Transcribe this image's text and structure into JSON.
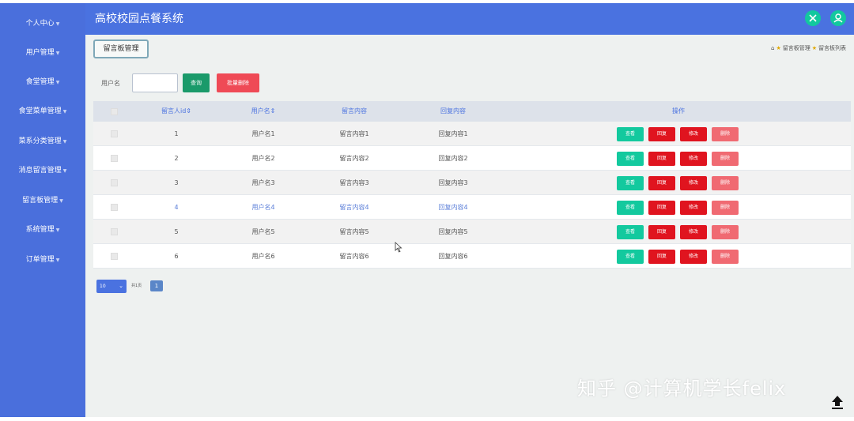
{
  "app": {
    "title": "高校校园点餐系统"
  },
  "sidebar": {
    "items": [
      {
        "label": "个人中心"
      },
      {
        "label": "用户管理"
      },
      {
        "label": "食堂管理"
      },
      {
        "label": "食堂菜单管理"
      },
      {
        "label": "菜系分类管理"
      },
      {
        "label": "消息留言管理"
      },
      {
        "label": "留言板管理"
      },
      {
        "label": "系统管理"
      },
      {
        "label": "订单管理"
      }
    ]
  },
  "header": {
    "icons": [
      "expand-icon",
      "user-icon"
    ]
  },
  "page": {
    "tab_label": "留言板管理",
    "breadcrumb": {
      "level1": "留言板管理",
      "level2": "留言板列表"
    }
  },
  "search": {
    "label": "用户名",
    "value": "",
    "query_button": "查询",
    "batch_delete_button": "批量删除"
  },
  "table": {
    "headers": [
      "留言人id⇕",
      "用户名⇕",
      "留言内容",
      "回复内容",
      "操作"
    ],
    "action_labels": {
      "view": "查看",
      "reply": "回复",
      "edit": "修改",
      "delete": "删除"
    },
    "rows": [
      {
        "id": "1",
        "username": "用户名1",
        "content": "留言内容1",
        "reply": "回复内容1"
      },
      {
        "id": "2",
        "username": "用户名2",
        "content": "留言内容2",
        "reply": "回复内容2"
      },
      {
        "id": "3",
        "username": "用户名3",
        "content": "留言内容3",
        "reply": "回复内容3"
      },
      {
        "id": "4",
        "username": "用户名4",
        "content": "留言内容4",
        "reply": "回复内容4"
      },
      {
        "id": "5",
        "username": "用户名5",
        "content": "留言内容5",
        "reply": "回复内容5"
      },
      {
        "id": "6",
        "username": "用户名6",
        "content": "留言内容6",
        "reply": "回复内容6"
      }
    ]
  },
  "pagination": {
    "page_size": "10",
    "total_text": "共1页",
    "current_page": "1"
  },
  "watermark": {
    "text": "知乎 @计算机学长felix"
  },
  "colors": {
    "sidebar": "#4a6fdc",
    "topbar": "#4a72e0",
    "accent_green": "#13c99e",
    "danger_red": "#e0141f"
  }
}
